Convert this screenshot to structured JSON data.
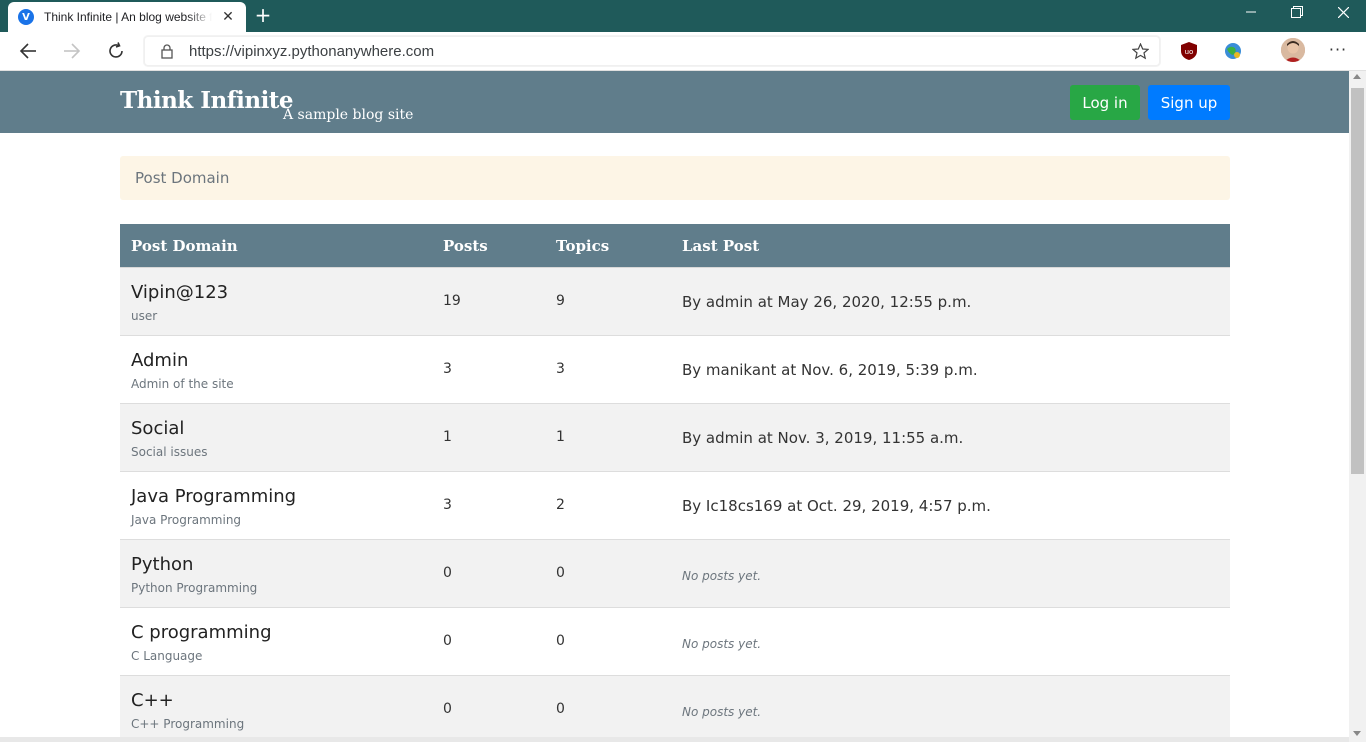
{
  "browser": {
    "tab_title": "Think Infinite | An blog website for",
    "tab_favicon_letter": "V",
    "url": "https://vipinxyz.pythonanywhere.com"
  },
  "site": {
    "brand": "Think Infinite",
    "tagline": "A sample blog site",
    "login_label": "Log in",
    "signup_label": "Sign up",
    "colors": {
      "header": "#607d8b",
      "login": "#28a745",
      "signup": "#007bff",
      "breadcrumb_bg": "#fdf5e6"
    }
  },
  "breadcrumb": "Post Domain",
  "table": {
    "headers": {
      "domain": "Post Domain",
      "posts": "Posts",
      "topics": "Topics",
      "last_post": "Last Post"
    },
    "rows": [
      {
        "name": "Vipin@123",
        "desc": "user",
        "posts": "19",
        "topics": "9",
        "last": "By admin at May 26, 2020, 12:55 p.m."
      },
      {
        "name": "Admin",
        "desc": "Admin of the site",
        "posts": "3",
        "topics": "3",
        "last": "By manikant at Nov. 6, 2019, 5:39 p.m."
      },
      {
        "name": "Social",
        "desc": "Social issues",
        "posts": "1",
        "topics": "1",
        "last": "By admin at Nov. 3, 2019, 11:55 a.m."
      },
      {
        "name": "Java Programming",
        "desc": "Java Programming",
        "posts": "3",
        "topics": "2",
        "last": "By Ic18cs169 at Oct. 29, 2019, 4:57 p.m."
      },
      {
        "name": "Python",
        "desc": "Python Programming",
        "posts": "0",
        "topics": "0",
        "last": "No posts yet."
      },
      {
        "name": "C programming",
        "desc": "C Language",
        "posts": "0",
        "topics": "0",
        "last": "No posts yet."
      },
      {
        "name": "C++",
        "desc": "C++ Programming",
        "posts": "0",
        "topics": "0",
        "last": "No posts yet."
      }
    ]
  }
}
